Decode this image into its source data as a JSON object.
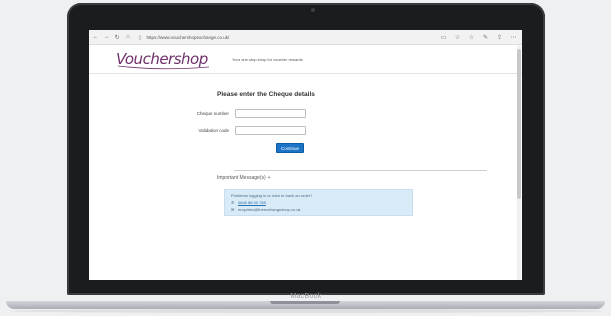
{
  "device": {
    "brand_label": "MacBook"
  },
  "browser": {
    "url": "https://www.vouchershopexchange.co.uk/",
    "icons": [
      "back-icon",
      "forward-icon",
      "refresh-icon",
      "home-icon",
      "reading-view-icon",
      "favorite-icon",
      "favorites-list-icon",
      "notes-icon",
      "share-icon",
      "more-icon"
    ]
  },
  "site": {
    "logo_text": "Vouchershop",
    "tagline": "Your one stop shop for voucher rewards"
  },
  "form": {
    "title": "Please enter the Cheque details",
    "cheque_number_label": "Cheque number",
    "cheque_number_value": "",
    "validation_code_label": "Validation code",
    "validation_code_value": "",
    "continue_label": "Continue"
  },
  "messages": {
    "heading": "Important Message(s)",
    "heading_toggle": "+",
    "intro": "Problems logging in or wish to track an order?",
    "phone": "0845 88 00 789",
    "email": "enquiries@theexchangeshop.co.uk"
  },
  "colors": {
    "brand_purple": "#6e2f6b",
    "button_blue": "#1b73c5",
    "message_bg": "#d9ebf7"
  }
}
